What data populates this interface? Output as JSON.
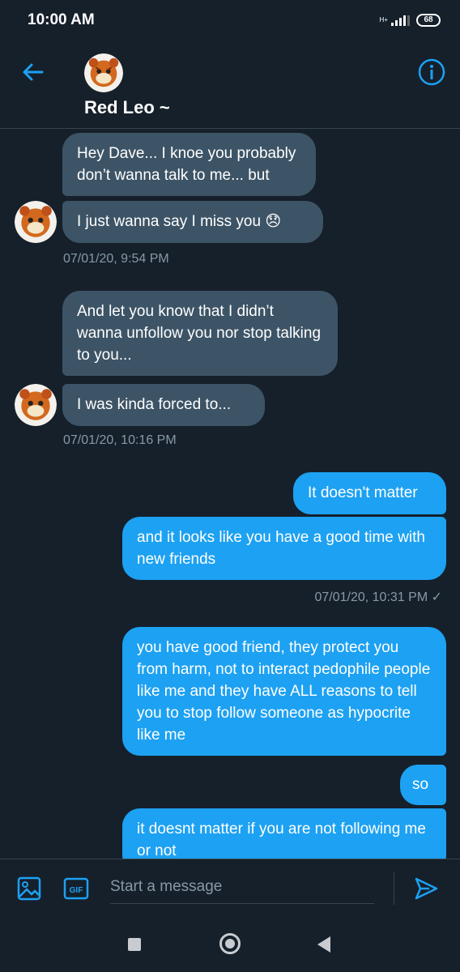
{
  "status_bar": {
    "time": "10:00 AM",
    "network": "H+",
    "battery": "68"
  },
  "header": {
    "contact_name": "Red Leo ~"
  },
  "colors": {
    "accent": "#1da1f2",
    "background": "#15202b",
    "incoming_bubble": "#3d5466",
    "muted_text": "#8899a6"
  },
  "messages": [
    {
      "text": "Hey Dave... I knoe you probably don’t wanna talk to me... but"
    },
    {
      "text": "I just wanna say I miss you 😞"
    },
    {
      "timestamp": "07/01/20, 9:54 PM"
    },
    {
      "text": "And let you know that I didn’t wanna unfollow you nor stop talking to you..."
    },
    {
      "text": "I was kinda forced to..."
    },
    {
      "timestamp": "07/01/20, 10:16 PM"
    },
    {
      "text": "It doesn't matter"
    },
    {
      "text": "and it looks like you have a good time with new friends"
    },
    {
      "timestamp": "07/01/20, 10:31 PM ✓"
    },
    {
      "text": "you have good friend, they protect you from harm, not to interact pedophile people like me and they have ALL reasons to tell you to stop follow someone as hypocrite like me"
    },
    {
      "text": "so"
    },
    {
      "text": "it doesnt matter if you are not following me or not"
    }
  ],
  "composer": {
    "placeholder": "Start a message",
    "gif_label": "GIF"
  },
  "icons": [
    "back-arrow-icon",
    "info-icon",
    "image-icon",
    "gif-icon",
    "send-icon",
    "recents-icon",
    "home-icon",
    "back-nav-icon"
  ]
}
